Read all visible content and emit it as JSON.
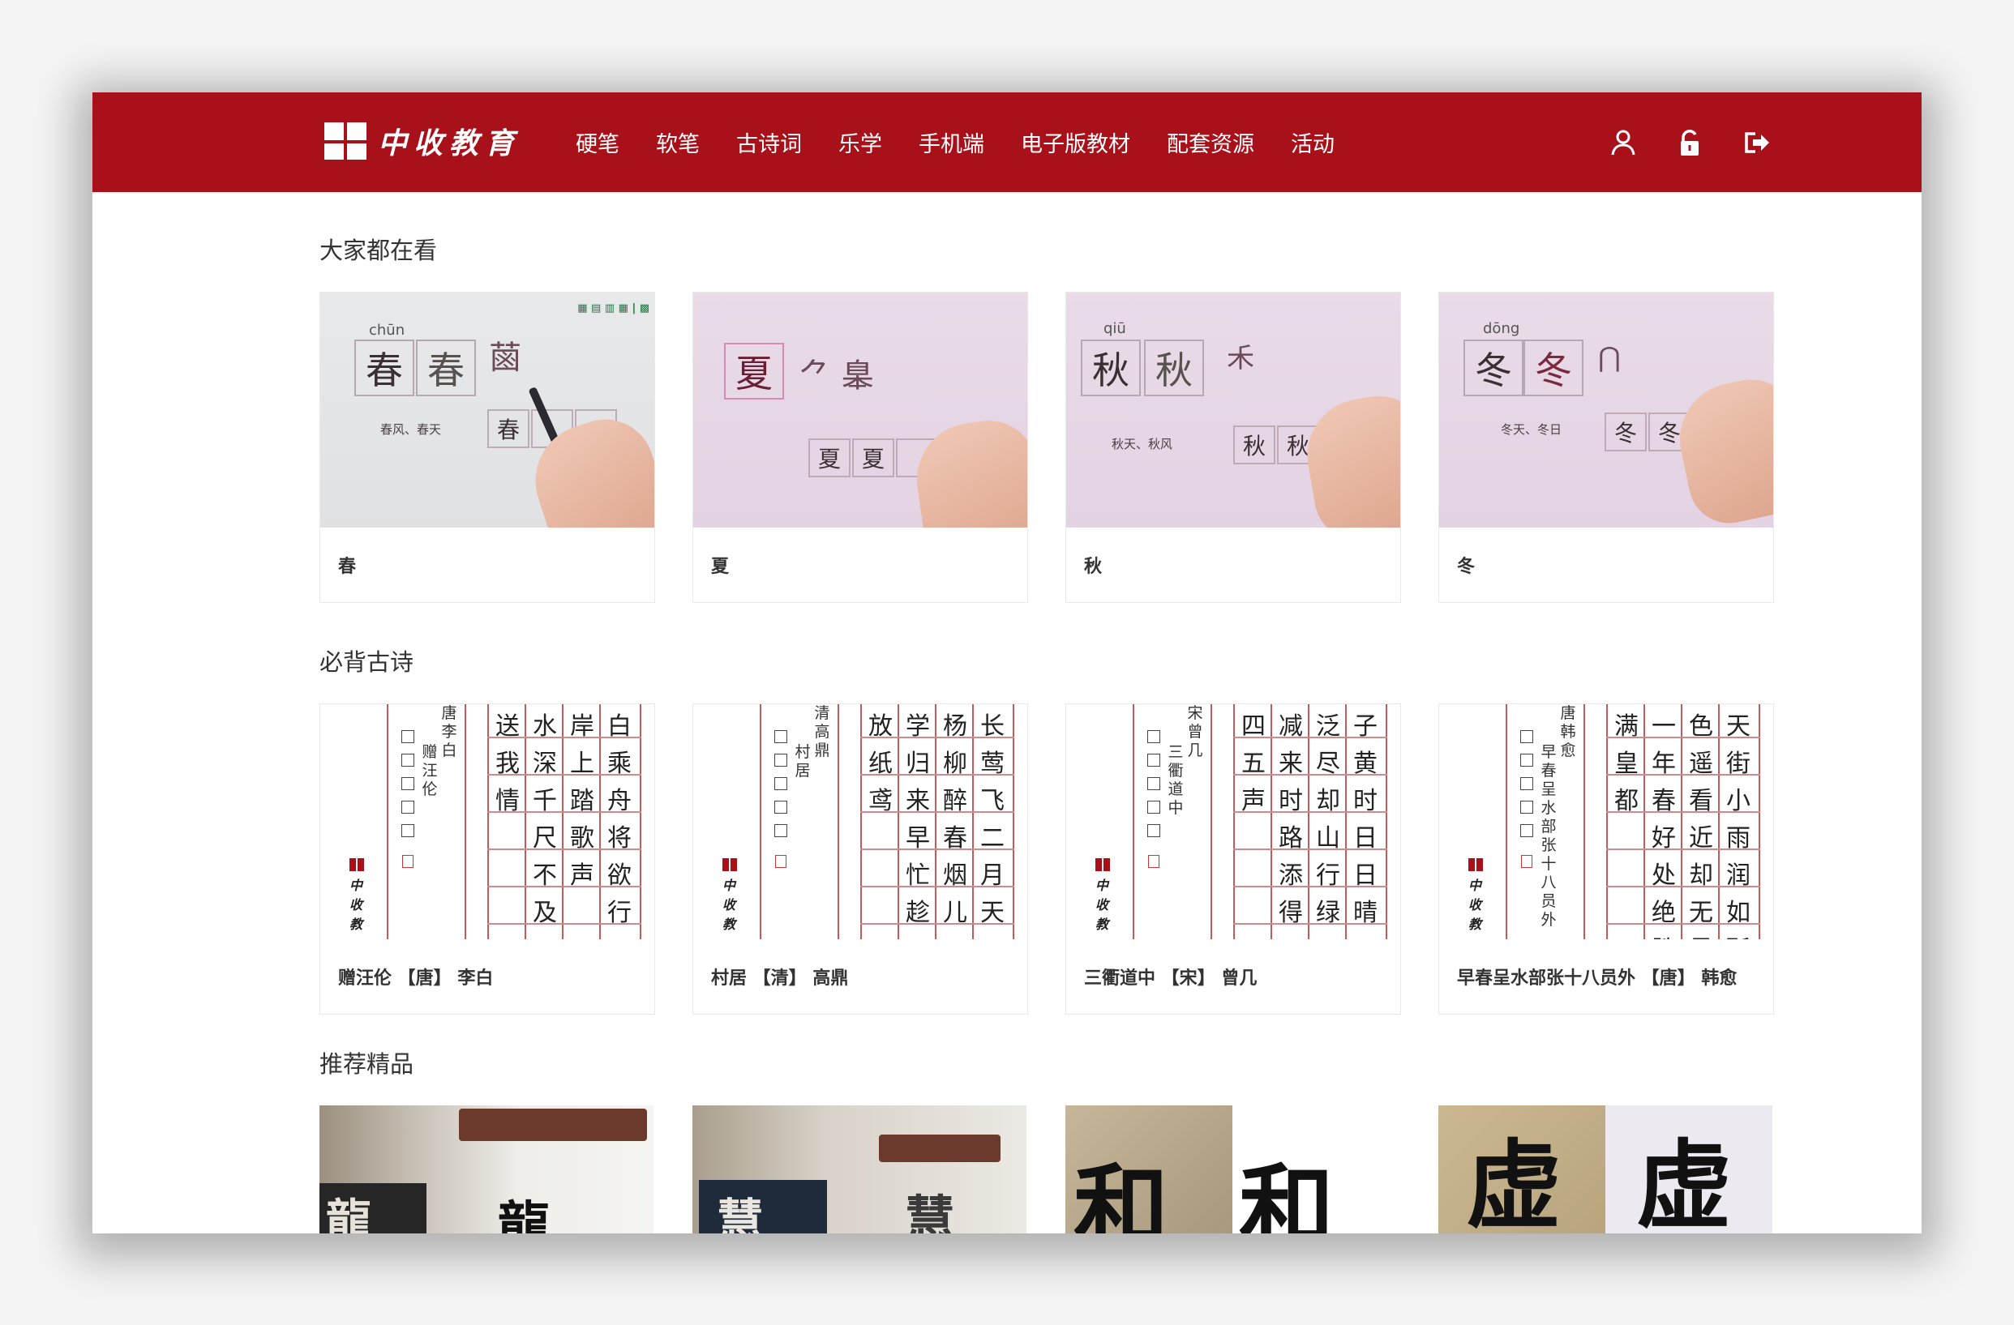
{
  "header": {
    "logo_text": "中收教育",
    "nav": [
      "硬笔",
      "软笔",
      "古诗词",
      "乐学",
      "手机端",
      "电子版教材",
      "配套资源",
      "活动"
    ],
    "icons": [
      "user-icon",
      "unlock-icon",
      "logout-icon"
    ]
  },
  "sections": {
    "popular": {
      "title": "大家都在看",
      "cards": [
        {
          "caption": "春",
          "char": "春",
          "pinyin": "chūn",
          "words": "春风、春天"
        },
        {
          "caption": "夏",
          "char": "夏",
          "pinyin": "",
          "words": ""
        },
        {
          "caption": "秋",
          "char": "秋",
          "pinyin": "qiū",
          "words": "秋天、秋风"
        },
        {
          "caption": "冬",
          "char": "冬",
          "pinyin": "dōng",
          "words": "冬天、冬日"
        }
      ]
    },
    "poems": {
      "title": "必背古诗",
      "cards": [
        {
          "caption": "赠汪伦 【唐】 李白",
          "author_v": "唐李白",
          "title_v": "赠汪伦",
          "cols": [
            "白乘舟将欲行",
            "岸上踏歌声",
            "水深千尺不及",
            "送我情"
          ]
        },
        {
          "caption": "村居 【清】 高鼎",
          "author_v": "清高鼎",
          "title_v": "村居",
          "cols": [
            "长莺飞二月天",
            "杨柳醉春烟儿",
            "学归来早忙趁",
            "放纸鸢"
          ]
        },
        {
          "caption": "三衢道中 【宋】 曾几",
          "author_v": "宋曾几",
          "title_v": "三衢道中",
          "cols": [
            "子黄时日日晴",
            "泛尽却山行绿",
            "减来时路添得",
            "四五声"
          ]
        },
        {
          "caption": "早春呈水部张十八员外 【唐】 韩愈",
          "author_v": "唐韩愈",
          "title_v": "早春呈水部张十八员外",
          "cols": [
            "天街小雨润如酥",
            "色遥看近却无最",
            "一年春好处绝胜",
            "满皇都"
          ]
        }
      ]
    },
    "featured": {
      "title": "推荐精品",
      "chars": [
        "龍",
        "慧",
        "和",
        "虚"
      ]
    }
  },
  "colors": {
    "brand_red": "#a8101a",
    "page_bg": "#ffffff",
    "grid_red": "#c25b5b"
  }
}
